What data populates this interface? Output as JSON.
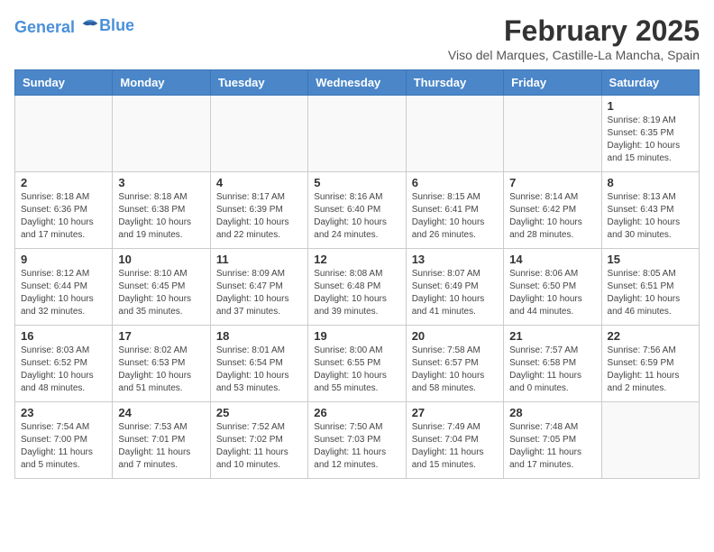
{
  "header": {
    "logo_line1": "General",
    "logo_line2": "Blue",
    "month_title": "February 2025",
    "location": "Viso del Marques, Castille-La Mancha, Spain"
  },
  "days_of_week": [
    "Sunday",
    "Monday",
    "Tuesday",
    "Wednesday",
    "Thursday",
    "Friday",
    "Saturday"
  ],
  "weeks": [
    [
      {
        "day": "",
        "info": ""
      },
      {
        "day": "",
        "info": ""
      },
      {
        "day": "",
        "info": ""
      },
      {
        "day": "",
        "info": ""
      },
      {
        "day": "",
        "info": ""
      },
      {
        "day": "",
        "info": ""
      },
      {
        "day": "1",
        "info": "Sunrise: 8:19 AM\nSunset: 6:35 PM\nDaylight: 10 hours and 15 minutes."
      }
    ],
    [
      {
        "day": "2",
        "info": "Sunrise: 8:18 AM\nSunset: 6:36 PM\nDaylight: 10 hours and 17 minutes."
      },
      {
        "day": "3",
        "info": "Sunrise: 8:18 AM\nSunset: 6:38 PM\nDaylight: 10 hours and 19 minutes."
      },
      {
        "day": "4",
        "info": "Sunrise: 8:17 AM\nSunset: 6:39 PM\nDaylight: 10 hours and 22 minutes."
      },
      {
        "day": "5",
        "info": "Sunrise: 8:16 AM\nSunset: 6:40 PM\nDaylight: 10 hours and 24 minutes."
      },
      {
        "day": "6",
        "info": "Sunrise: 8:15 AM\nSunset: 6:41 PM\nDaylight: 10 hours and 26 minutes."
      },
      {
        "day": "7",
        "info": "Sunrise: 8:14 AM\nSunset: 6:42 PM\nDaylight: 10 hours and 28 minutes."
      },
      {
        "day": "8",
        "info": "Sunrise: 8:13 AM\nSunset: 6:43 PM\nDaylight: 10 hours and 30 minutes."
      }
    ],
    [
      {
        "day": "9",
        "info": "Sunrise: 8:12 AM\nSunset: 6:44 PM\nDaylight: 10 hours and 32 minutes."
      },
      {
        "day": "10",
        "info": "Sunrise: 8:10 AM\nSunset: 6:45 PM\nDaylight: 10 hours and 35 minutes."
      },
      {
        "day": "11",
        "info": "Sunrise: 8:09 AM\nSunset: 6:47 PM\nDaylight: 10 hours and 37 minutes."
      },
      {
        "day": "12",
        "info": "Sunrise: 8:08 AM\nSunset: 6:48 PM\nDaylight: 10 hours and 39 minutes."
      },
      {
        "day": "13",
        "info": "Sunrise: 8:07 AM\nSunset: 6:49 PM\nDaylight: 10 hours and 41 minutes."
      },
      {
        "day": "14",
        "info": "Sunrise: 8:06 AM\nSunset: 6:50 PM\nDaylight: 10 hours and 44 minutes."
      },
      {
        "day": "15",
        "info": "Sunrise: 8:05 AM\nSunset: 6:51 PM\nDaylight: 10 hours and 46 minutes."
      }
    ],
    [
      {
        "day": "16",
        "info": "Sunrise: 8:03 AM\nSunset: 6:52 PM\nDaylight: 10 hours and 48 minutes."
      },
      {
        "day": "17",
        "info": "Sunrise: 8:02 AM\nSunset: 6:53 PM\nDaylight: 10 hours and 51 minutes."
      },
      {
        "day": "18",
        "info": "Sunrise: 8:01 AM\nSunset: 6:54 PM\nDaylight: 10 hours and 53 minutes."
      },
      {
        "day": "19",
        "info": "Sunrise: 8:00 AM\nSunset: 6:55 PM\nDaylight: 10 hours and 55 minutes."
      },
      {
        "day": "20",
        "info": "Sunrise: 7:58 AM\nSunset: 6:57 PM\nDaylight: 10 hours and 58 minutes."
      },
      {
        "day": "21",
        "info": "Sunrise: 7:57 AM\nSunset: 6:58 PM\nDaylight: 11 hours and 0 minutes."
      },
      {
        "day": "22",
        "info": "Sunrise: 7:56 AM\nSunset: 6:59 PM\nDaylight: 11 hours and 2 minutes."
      }
    ],
    [
      {
        "day": "23",
        "info": "Sunrise: 7:54 AM\nSunset: 7:00 PM\nDaylight: 11 hours and 5 minutes."
      },
      {
        "day": "24",
        "info": "Sunrise: 7:53 AM\nSunset: 7:01 PM\nDaylight: 11 hours and 7 minutes."
      },
      {
        "day": "25",
        "info": "Sunrise: 7:52 AM\nSunset: 7:02 PM\nDaylight: 11 hours and 10 minutes."
      },
      {
        "day": "26",
        "info": "Sunrise: 7:50 AM\nSunset: 7:03 PM\nDaylight: 11 hours and 12 minutes."
      },
      {
        "day": "27",
        "info": "Sunrise: 7:49 AM\nSunset: 7:04 PM\nDaylight: 11 hours and 15 minutes."
      },
      {
        "day": "28",
        "info": "Sunrise: 7:48 AM\nSunset: 7:05 PM\nDaylight: 11 hours and 17 minutes."
      },
      {
        "day": "",
        "info": ""
      }
    ]
  ]
}
